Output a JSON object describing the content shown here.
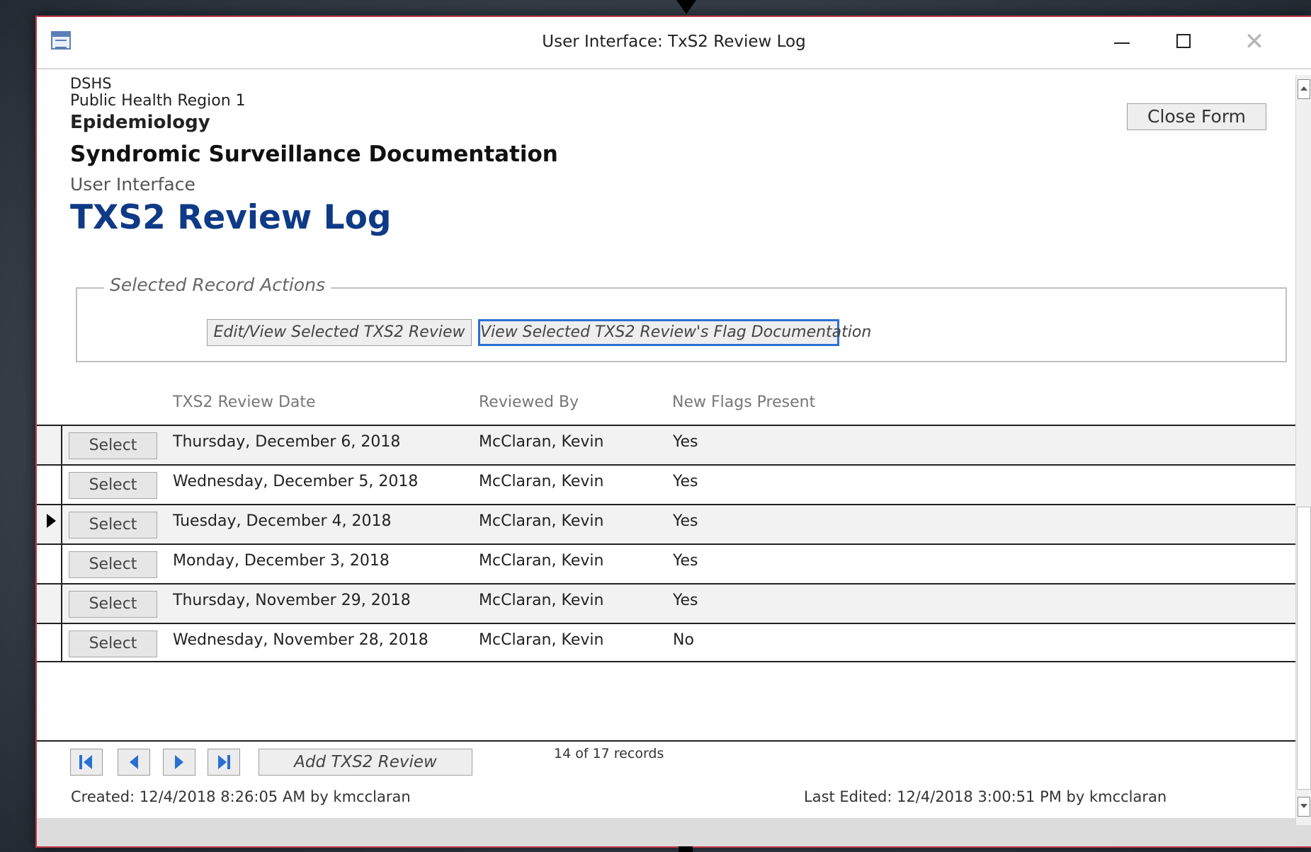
{
  "window": {
    "title": "User Interface: TxS2 Review Log",
    "close_symbol": "✕"
  },
  "header": {
    "org_line1": "DSHS",
    "org_line2": "Public Health Region 1",
    "org_line3": "Epidemiology",
    "section": "Syndromic Surveillance Documentation",
    "subsection": "User Interface",
    "form_title": "TXS2 Review Log",
    "close_form_label": "Close Form"
  },
  "actions": {
    "legend": "Selected Record Actions",
    "edit_label": "Edit/View Selected TXS2 Review",
    "view_flags_label": "View Selected TXS2 Review's Flag Documentation"
  },
  "columns": {
    "date": "TXS2 Review Date",
    "reviewed_by": "Reviewed By",
    "new_flags": "New Flags Present"
  },
  "rows": [
    {
      "select_label": "Select",
      "date": "Thursday, December 6, 2018",
      "reviewed_by": "McClaran, Kevin",
      "new_flags": "Yes",
      "current": false
    },
    {
      "select_label": "Select",
      "date": "Wednesday, December 5, 2018",
      "reviewed_by": "McClaran, Kevin",
      "new_flags": "Yes",
      "current": false
    },
    {
      "select_label": "Select",
      "date": "Tuesday, December 4, 2018",
      "reviewed_by": "McClaran, Kevin",
      "new_flags": "Yes",
      "current": true
    },
    {
      "select_label": "Select",
      "date": "Monday, December 3, 2018",
      "reviewed_by": "McClaran, Kevin",
      "new_flags": "Yes",
      "current": false
    },
    {
      "select_label": "Select",
      "date": "Thursday, November 29, 2018",
      "reviewed_by": "McClaran, Kevin",
      "new_flags": "Yes",
      "current": false
    },
    {
      "select_label": "Select",
      "date": "Wednesday, November 28, 2018",
      "reviewed_by": "McClaran, Kevin",
      "new_flags": "No",
      "current": false
    }
  ],
  "footer": {
    "add_label": "Add TXS2 Review",
    "records": "14 of 17 records",
    "created": "Created: 12/4/2018 8:26:05 AM by kmcclaran",
    "last_edited": "Last Edited: 12/4/2018 3:00:51 PM by kmcclaran"
  },
  "icons": {
    "app": "form-icon",
    "nav": [
      "first-record-icon",
      "previous-record-icon",
      "next-record-icon",
      "last-record-icon"
    ],
    "row_pointer": "current-record-arrow-icon"
  },
  "colors": {
    "title_blue": "#0e3a86",
    "focus_blue": "#2a70d6",
    "window_border": "#c23a4a"
  }
}
